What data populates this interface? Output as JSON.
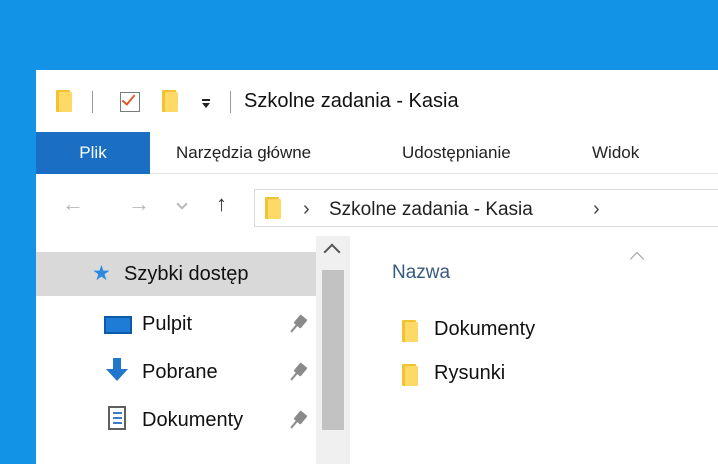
{
  "colors": {
    "desktop": "#1293e6",
    "file_tab": "#1a6fc4",
    "selected_item": "#d9d9d9",
    "folder": "#ffd966"
  },
  "titlebar": {
    "title": "Szkolne zadania - Kasia",
    "quick_access_icons": [
      "folder-icon",
      "properties-icon",
      "new-folder-icon",
      "customize-dropdown-icon"
    ]
  },
  "ribbon": {
    "tabs": [
      "Plik",
      "Narzędzia główne",
      "Udostępnianie",
      "Widok"
    ]
  },
  "address_bar": {
    "breadcrumb": "Szkolne zadania - Kasia",
    "back_glyph": "←",
    "forward_glyph": "→",
    "up_glyph": "↑",
    "chevron_glyph": "›"
  },
  "nav_pane": {
    "quick_access": {
      "label": "Szybki dostęp",
      "icon": "star-icon"
    },
    "items": [
      {
        "label": "Pulpit",
        "icon": "desktop-icon",
        "pinned": true
      },
      {
        "label": "Pobrane",
        "icon": "download-icon",
        "pinned": true
      },
      {
        "label": "Dokumenty",
        "icon": "documents-icon",
        "pinned": true
      }
    ]
  },
  "content": {
    "column_header": "Nazwa",
    "sort": "ascending",
    "files": [
      {
        "name": "Dokumenty",
        "icon": "folder-icon"
      },
      {
        "name": "Rysunki",
        "icon": "folder-icon"
      }
    ]
  }
}
